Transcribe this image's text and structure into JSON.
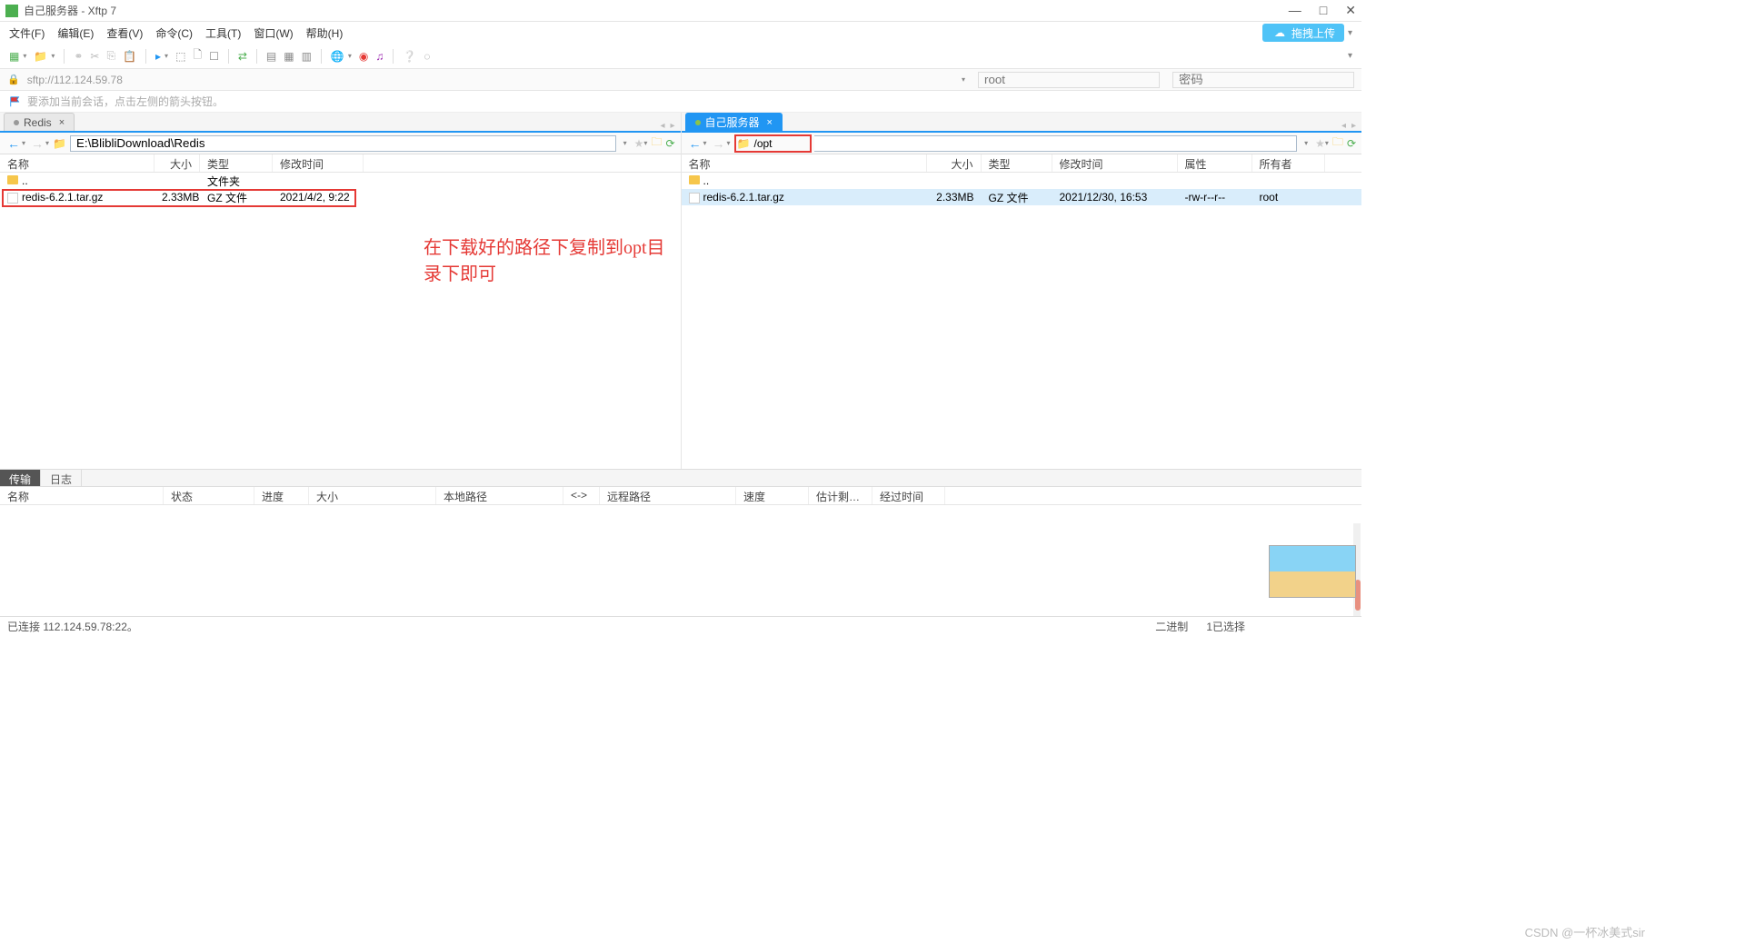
{
  "window": {
    "title": "自己服务器 - Xftp 7",
    "minimize": "—",
    "maximize": "□",
    "close": "✕"
  },
  "menu": {
    "file": "文件(F)",
    "edit": "编辑(E)",
    "view": "查看(V)",
    "commands": "命令(C)",
    "tools": "工具(T)",
    "window": "窗口(W)",
    "help": "帮助(H)"
  },
  "drag_upload": {
    "label": "拖拽上传"
  },
  "address": {
    "url": "sftp://112.124.59.78",
    "user_placeholder": "root",
    "pwd_placeholder": "密码"
  },
  "hint": "要添加当前会话，点击左侧的箭头按钮。",
  "left_pane": {
    "tab": "Redis",
    "path": "E:\\BlibliDownload\\Redis",
    "columns": {
      "name": "名称",
      "size": "大小",
      "type": "类型",
      "mtime": "修改时间"
    },
    "parent": {
      "name": "..",
      "type": "文件夹"
    },
    "files": [
      {
        "name": "redis-6.2.1.tar.gz",
        "size": "2.33MB",
        "type": "GZ 文件",
        "mtime": "2021/4/2, 9:22"
      }
    ]
  },
  "right_pane": {
    "tab": "自己服务器",
    "path": "/opt",
    "columns": {
      "name": "名称",
      "size": "大小",
      "type": "类型",
      "mtime": "修改时间",
      "attr": "属性",
      "owner": "所有者"
    },
    "parent": {
      "name": ".."
    },
    "files": [
      {
        "name": "redis-6.2.1.tar.gz",
        "size": "2.33MB",
        "type": "GZ 文件",
        "mtime": "2021/12/30, 16:53",
        "attr": "-rw-r--r--",
        "owner": "root"
      }
    ]
  },
  "annotation_text": "在下载好的路径下复制到opt目录下即可",
  "bottom": {
    "tab_transfer": "传输",
    "tab_log": "日志",
    "columns": {
      "name": "名称",
      "status": "状态",
      "progress": "进度",
      "size": "大小",
      "local_path": "本地路径",
      "arrow": "<->",
      "remote_path": "远程路径",
      "speed": "速度",
      "est": "估计剩…",
      "elapsed": "经过时间"
    }
  },
  "status": {
    "connected": "已连接 112.124.59.78:22。",
    "binary": "二进制",
    "selected": "1已选择"
  },
  "watermark": "CSDN @一杯冰美式sir"
}
